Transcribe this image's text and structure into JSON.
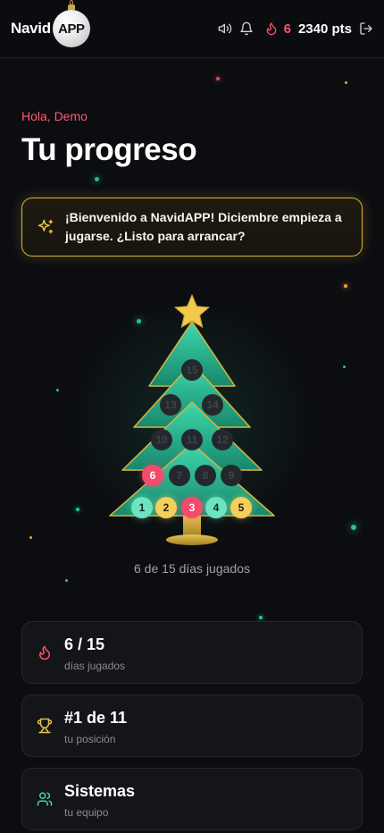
{
  "header": {
    "logo_text": "Navid",
    "logo_badge": "APP",
    "streak": "6",
    "points": "2340 pts",
    "icons": [
      "volume-icon",
      "bell-icon",
      "flame-icon",
      "logout-icon"
    ]
  },
  "greeting": "Hola, Demo",
  "title": "Tu progreso",
  "banner": {
    "icon": "sparkles-icon",
    "text": "¡Bienvenido a NavidAPP! Diciembre empieza a jugarse. ¿Listo para arrancar?"
  },
  "tree": {
    "balls": [
      {
        "n": "15",
        "state": "locked"
      },
      {
        "n": "13",
        "state": "locked"
      },
      {
        "n": "14",
        "state": "locked"
      },
      {
        "n": "10",
        "state": "locked"
      },
      {
        "n": "11",
        "state": "locked"
      },
      {
        "n": "12",
        "state": "locked"
      },
      {
        "n": "6",
        "state": "played"
      },
      {
        "n": "7",
        "state": "locked"
      },
      {
        "n": "8",
        "state": "locked"
      },
      {
        "n": "9",
        "state": "locked"
      },
      {
        "n": "1",
        "state": "played"
      },
      {
        "n": "2",
        "state": "played"
      },
      {
        "n": "3",
        "state": "played"
      },
      {
        "n": "4",
        "state": "played"
      },
      {
        "n": "5",
        "state": "played"
      }
    ],
    "played_text": "6 de 15 días jugados"
  },
  "stats": [
    {
      "icon": "flame-icon",
      "value": "6 / 15",
      "label": "días jugados"
    },
    {
      "icon": "trophy-icon",
      "value": "#1 de 11",
      "label": "tu posición"
    },
    {
      "icon": "users-icon",
      "value": "Sistemas",
      "label": "tu equipo"
    }
  ],
  "colors": {
    "accent_red": "#fb4f6a",
    "gold": "#d9b43f",
    "mint": "#6de3c2",
    "background": "#0c0d10"
  }
}
